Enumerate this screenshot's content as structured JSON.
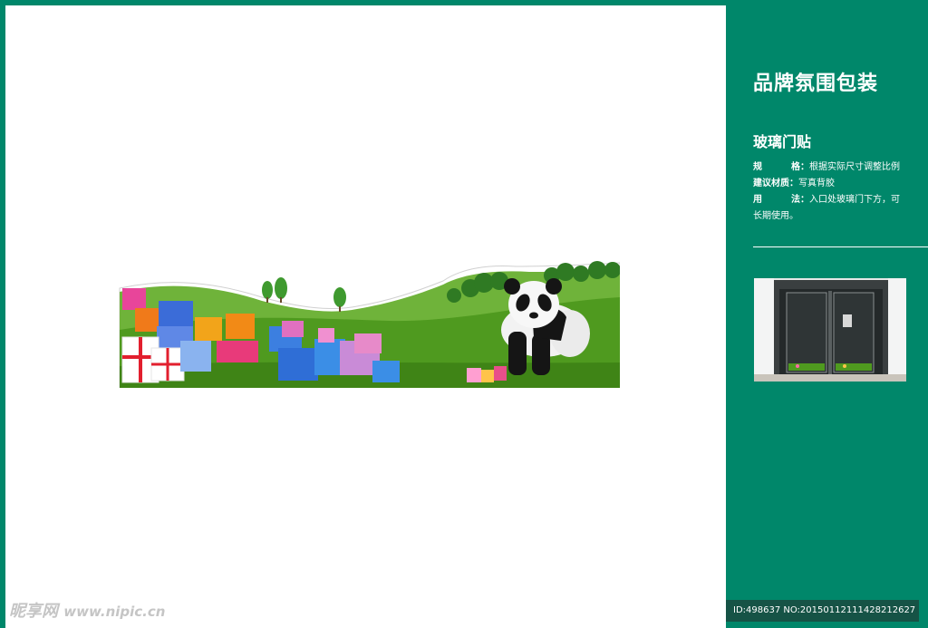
{
  "panel": {
    "title": "品牌氛围包装",
    "section_title": "玻璃门贴",
    "specs": [
      {
        "label_a": "规",
        "label_b": "格",
        "sep": "：",
        "value": "根据实际尺寸调整比例"
      },
      {
        "label_a": "建议材质",
        "label_b": "",
        "sep": "：",
        "value": "写真背胶"
      },
      {
        "label_a": "用",
        "label_b": "法",
        "sep": "：",
        "value": "入口处玻璃门下方，可长期使用。"
      }
    ]
  },
  "watermark": {
    "brand": "昵享网",
    "url": "www.nipic.cn"
  },
  "id_bar": {
    "text": "ID:498637 NO:20150112111428212627"
  },
  "colors": {
    "brand_green": "#00876a",
    "grass": "#4f9a1f",
    "canvas": "#ffffff"
  }
}
